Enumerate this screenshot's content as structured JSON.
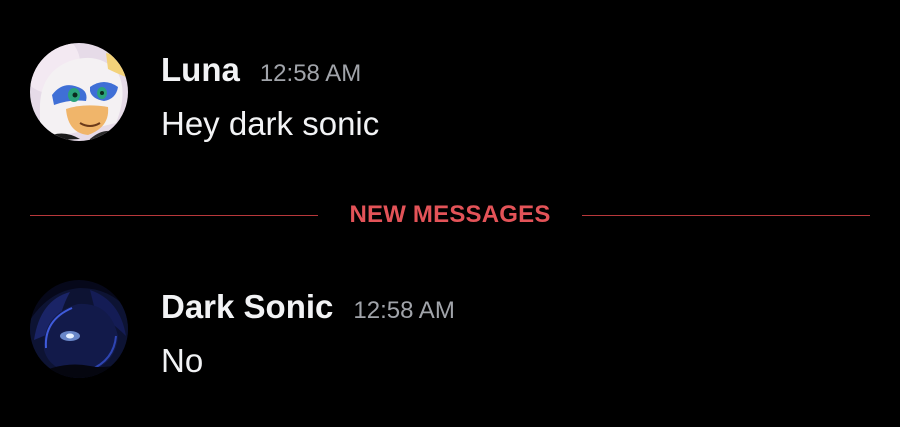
{
  "messages": [
    {
      "username": "Luna",
      "timestamp": "12:58 AM",
      "content": "Hey dark sonic",
      "avatar_icon": "bat-character-avatar"
    },
    {
      "username": "Dark Sonic",
      "timestamp": "12:58 AM",
      "content": "No",
      "avatar_icon": "hedgehog-character-avatar"
    }
  ],
  "divider": {
    "label": "NEW MESSAGES"
  },
  "colors": {
    "background": "#000000",
    "text": "#f2f3f5",
    "timestamp": "#a1a4aa",
    "new_messages": "#e35358",
    "divider_line": "#b8383b"
  }
}
